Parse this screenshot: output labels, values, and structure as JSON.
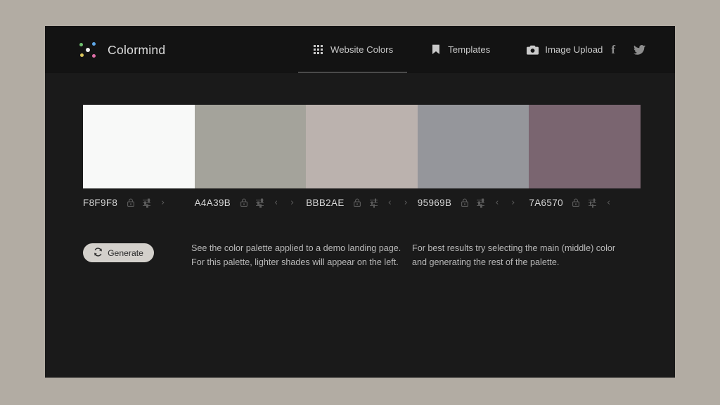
{
  "app": {
    "background_color": "#b2aca3",
    "card_background": "#1a1a1a",
    "header_background": "#131313"
  },
  "header": {
    "brand_name": "Colormind",
    "logo_dot_colors": [
      "#6fbf6f",
      "#5fa8e8",
      "#f2f2f2",
      "#d9c55c",
      "#e06fa8"
    ],
    "nav": [
      {
        "label": "Website Colors",
        "icon": "grid-icon",
        "active": true
      },
      {
        "label": "Templates",
        "icon": "bookmark-icon",
        "active": false
      },
      {
        "label": "Image Upload",
        "icon": "camera-icon",
        "active": false
      }
    ],
    "social": [
      {
        "name": "facebook-icon",
        "glyph": "f"
      },
      {
        "name": "twitter-icon",
        "glyph": "bird"
      }
    ],
    "active_tab_underline_color": "#4a4a4a"
  },
  "palette": {
    "swatches": [
      {
        "hex_label": "F8F9F8",
        "color": "#f8f9f8",
        "has_lock": true,
        "has_sliders": true,
        "has_prev": false,
        "has_next": true
      },
      {
        "hex_label": "A4A39B",
        "color": "#a4a39b",
        "has_lock": true,
        "has_sliders": true,
        "has_prev": true,
        "has_next": true
      },
      {
        "hex_label": "BBB2AE",
        "color": "#bbb2ae",
        "has_lock": true,
        "has_sliders": true,
        "has_prev": true,
        "has_next": true
      },
      {
        "hex_label": "95969B",
        "color": "#95969b",
        "has_lock": true,
        "has_sliders": true,
        "has_prev": true,
        "has_next": true
      },
      {
        "hex_label": "7A6570",
        "color": "#7a6570",
        "has_lock": true,
        "has_sliders": true,
        "has_prev": true,
        "has_next": false
      }
    ]
  },
  "actions": {
    "generate_label": "Generate",
    "generate_icon": "refresh-icon",
    "generate_button_color": "#d3d0cb"
  },
  "info": {
    "left": {
      "line1": "See the color palette applied to a demo landing page.",
      "line2": "For this palette, lighter shades will appear on the left."
    },
    "right": {
      "line1": "For best results try selecting the main (middle) color",
      "line2": "and generating the rest of the palette."
    }
  }
}
